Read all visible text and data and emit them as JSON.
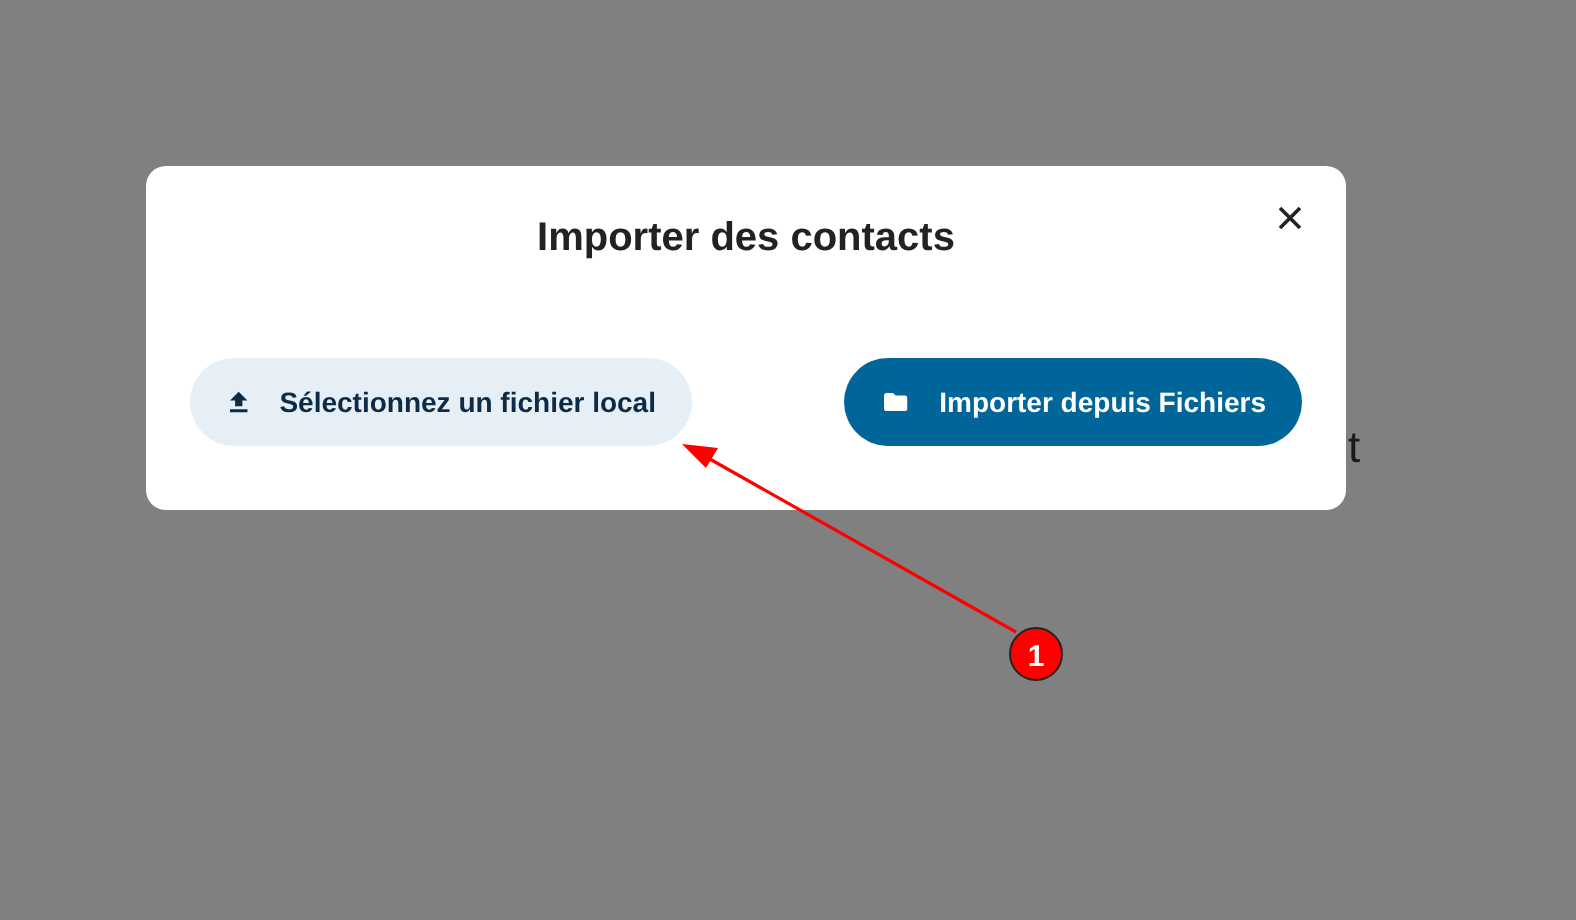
{
  "background_text": "t",
  "dialog": {
    "title": "Importer des contacts",
    "buttons": [
      {
        "label": "Sélectionnez un fichier local",
        "kind": "secondary"
      },
      {
        "label": "Importer depuis Fichiers",
        "kind": "primary"
      }
    ]
  },
  "annotation": {
    "marker": "1"
  }
}
